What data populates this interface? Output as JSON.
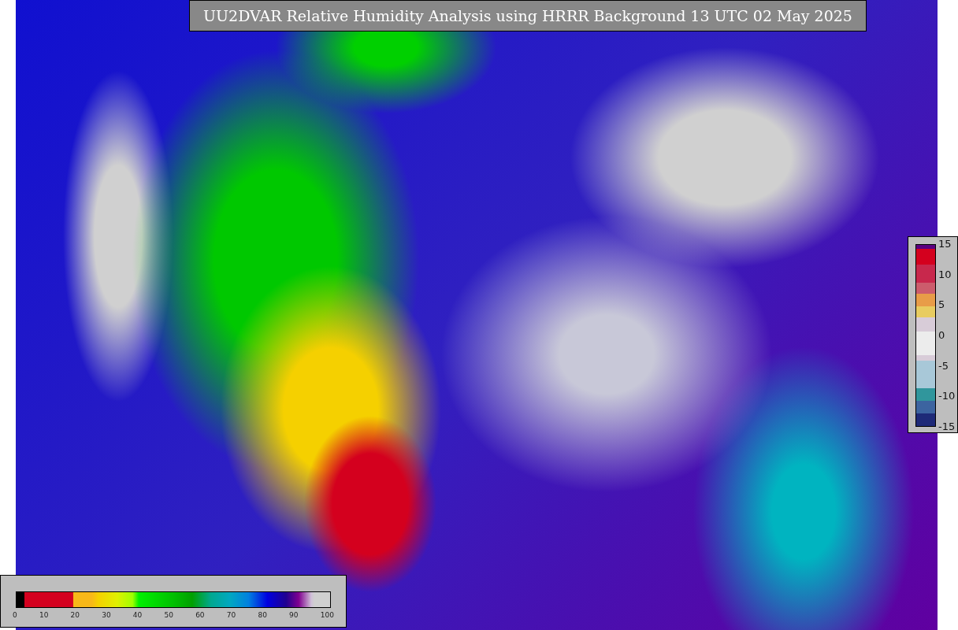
{
  "title": "UU2DVAR Relative Humidity Analysis using HRRR Background 13 UTC 02 May 2025",
  "bottom_colorbar": {
    "ticks": [
      "0",
      "10",
      "20",
      "30",
      "40",
      "50",
      "60",
      "70",
      "80",
      "90",
      "100"
    ]
  },
  "right_colorbar": {
    "ticks": [
      "15",
      "10",
      "5",
      "0",
      "-5",
      "-10",
      "-15"
    ]
  }
}
